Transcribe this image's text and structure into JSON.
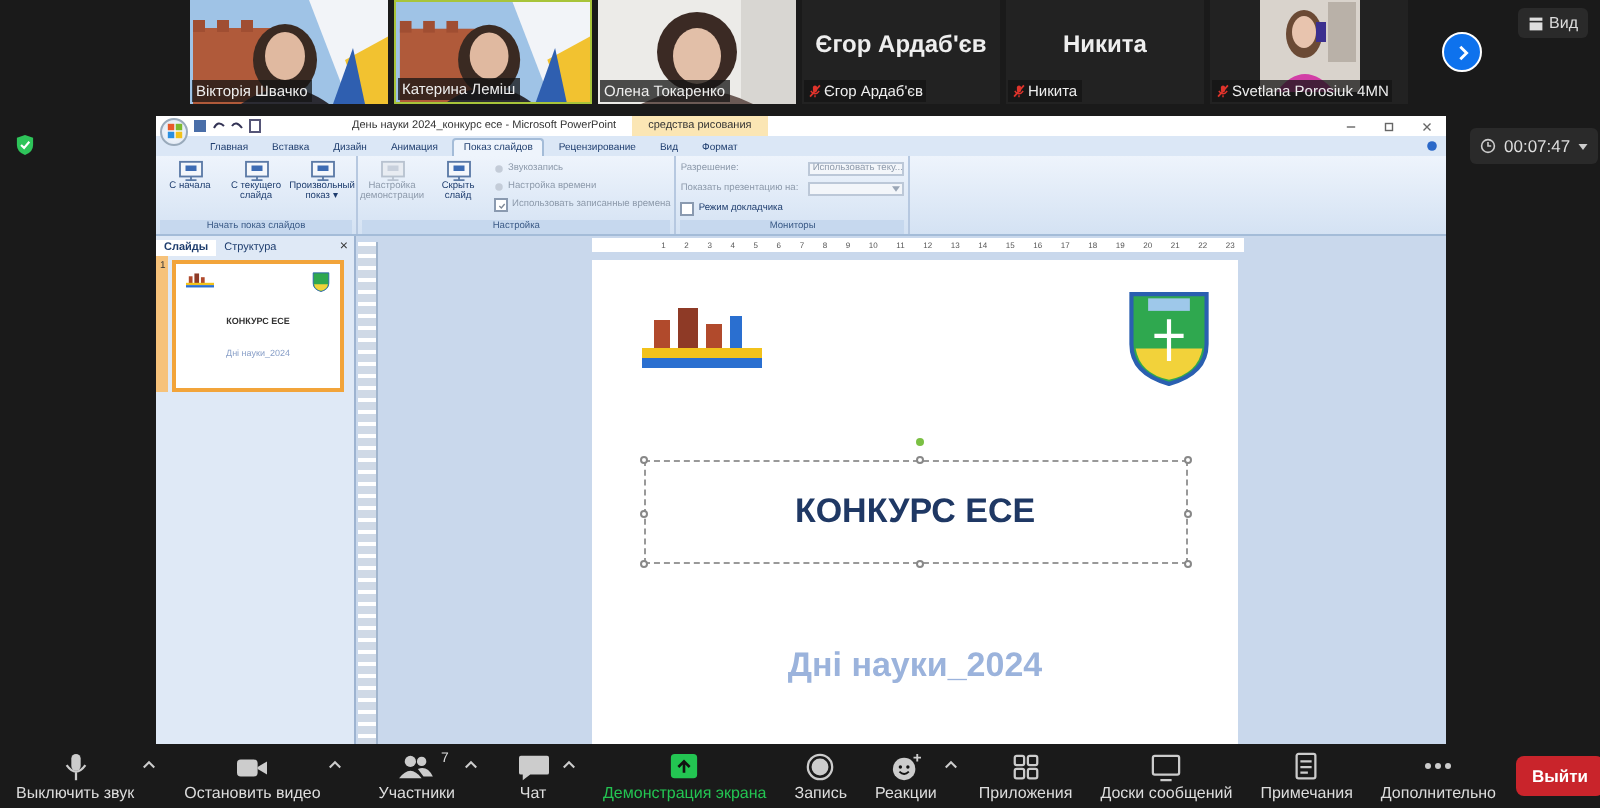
{
  "participants": [
    {
      "label": "Вікторія Швачко",
      "kind": "video",
      "active": false,
      "muted": false
    },
    {
      "label": "Катерина Леміш",
      "kind": "video",
      "active": true,
      "muted": false
    },
    {
      "label": "Олена Токаренко",
      "kind": "video",
      "active": false,
      "muted": false
    },
    {
      "name": "Єгор Ардаб'єв",
      "label": "Єгор Ардаб'єв",
      "kind": "name",
      "active": false,
      "muted": true
    },
    {
      "name": "Никита",
      "label": "Никита",
      "kind": "name",
      "active": false,
      "muted": true
    },
    {
      "label": "Svetlana Porosiuk 4MN",
      "kind": "portrait",
      "active": false,
      "muted": true
    }
  ],
  "view_button": "Вид",
  "timer": "00:07:47",
  "powerpoint": {
    "title": "День науки 2024_конкурс есе - Microsoft PowerPoint",
    "context_tab": "средства рисования",
    "tabs": [
      {
        "label": "Главная",
        "selected": false
      },
      {
        "label": "Вставка",
        "selected": false
      },
      {
        "label": "Дизайн",
        "selected": false
      },
      {
        "label": "Анимация",
        "selected": false
      },
      {
        "label": "Показ слайдов",
        "selected": true
      },
      {
        "label": "Рецензирование",
        "selected": false
      },
      {
        "label": "Вид",
        "selected": false
      },
      {
        "label": "Формат",
        "selected": false
      }
    ],
    "groups": [
      {
        "label": "Начать показ слайдов",
        "items": [
          {
            "kind": "big",
            "label": "С начала",
            "disabled": false
          },
          {
            "kind": "big",
            "label": "С текущего слайда",
            "disabled": false
          },
          {
            "kind": "big",
            "label": "Произвольный показ ▾",
            "disabled": false
          }
        ]
      },
      {
        "label": "Настройка",
        "items": [
          {
            "kind": "big",
            "label": "Настройка демонстрации",
            "disabled": true
          },
          {
            "kind": "big",
            "label": "Скрыть слайд",
            "disabled": false
          },
          {
            "kind": "row",
            "label": "Звукозапись",
            "disabled": true
          },
          {
            "kind": "row",
            "label": "Настройка времени",
            "disabled": true
          },
          {
            "kind": "check",
            "label": "Использовать записанные времена",
            "disabled": true,
            "checked": true
          }
        ]
      },
      {
        "label": "Мониторы",
        "items": [
          {
            "kind": "select",
            "label": "Разрешение:",
            "value": "Использовать теку...",
            "disabled": true
          },
          {
            "kind": "select",
            "label": "Показать презентацию на:",
            "value": "",
            "disabled": true
          },
          {
            "kind": "check",
            "label": "Режим докладчика",
            "disabled": false,
            "checked": false
          }
        ]
      }
    ],
    "slide_tabs": [
      {
        "label": "Слайды",
        "selected": true
      },
      {
        "label": "Структура",
        "selected": false
      }
    ],
    "panel_close": "×",
    "thumbnail": {
      "number": "1",
      "title": "КОНКУРС ЕСЕ",
      "subtitle": "Дні науки_2024",
      "selected": true
    },
    "ruler": [
      "1",
      "2",
      "3",
      "4",
      "5",
      "6",
      "7",
      "8",
      "9",
      "10",
      "11",
      "12",
      "13",
      "14",
      "15",
      "16",
      "17",
      "18",
      "19",
      "20",
      "21",
      "22",
      "23"
    ],
    "slide": {
      "title": "КОНКУРС ЕСЕ",
      "subtitle": "Дні науки_2024",
      "title_selected": true
    }
  },
  "toolbar": [
    {
      "label": "Выключить звук",
      "caret": true,
      "active": false
    },
    {
      "label": "Остановить видео",
      "caret": true,
      "active": false
    },
    {
      "label": "Участники",
      "caret": true,
      "active": false,
      "count": "7"
    },
    {
      "label": "Чат",
      "caret": true,
      "active": false
    },
    {
      "label": "Демонстрация экрана",
      "caret": false,
      "active": true
    },
    {
      "label": "Запись",
      "caret": false,
      "active": false
    },
    {
      "label": "Реакции",
      "caret": true,
      "active": false
    },
    {
      "label": "Приложения",
      "caret": false,
      "active": false
    },
    {
      "label": "Доски сообщений",
      "caret": false,
      "active": false
    },
    {
      "label": "Примечания",
      "caret": false,
      "active": false
    },
    {
      "label": "Дополнительно",
      "caret": false,
      "active": false
    }
  ],
  "leave_button": "Выйти"
}
